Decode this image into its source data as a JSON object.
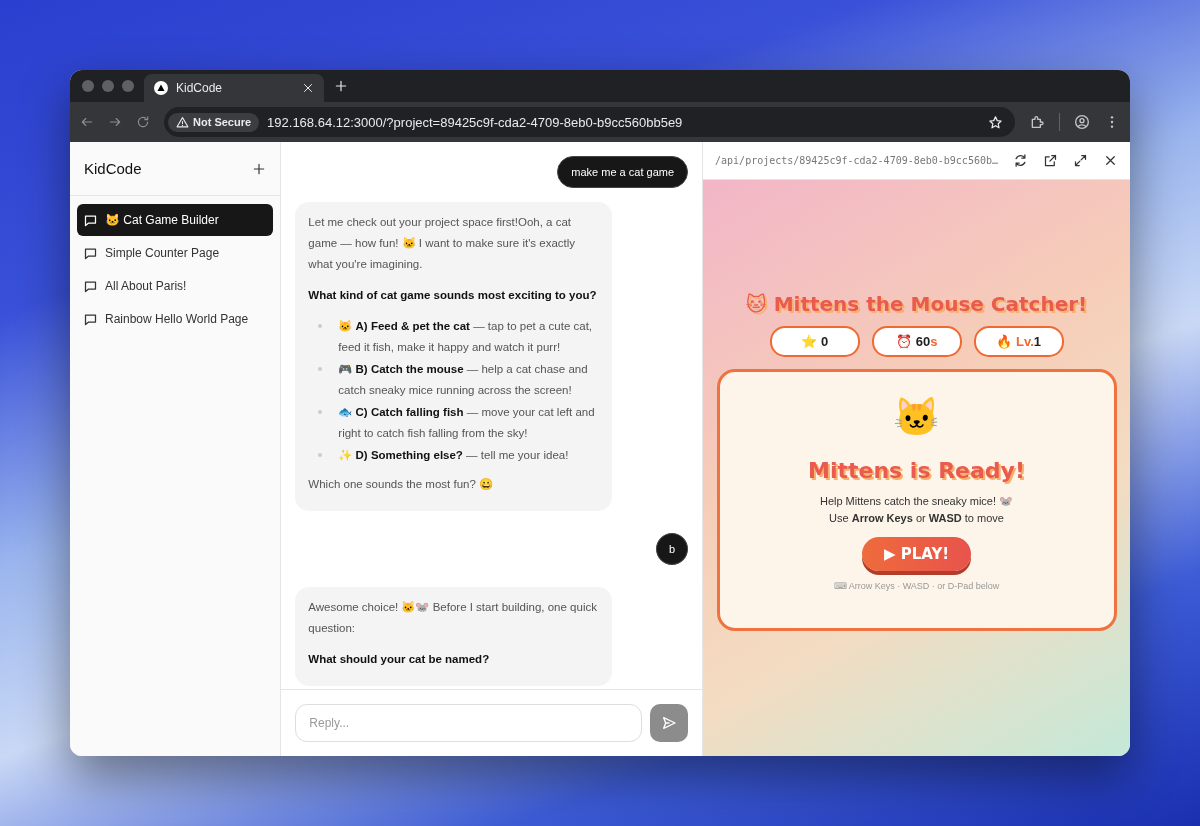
{
  "browser": {
    "tab": {
      "title": "KidCode",
      "selected": true
    },
    "security": "Not Secure",
    "url": "192.168.64.12:3000/?project=89425c9f-cda2-4709-8eb0-b9cc560bb5e9"
  },
  "sidebar": {
    "title": "KidCode",
    "items": [
      {
        "label": "🐱 Cat Game Builder",
        "selected": true
      },
      {
        "label": "Simple Counter Page",
        "selected": false
      },
      {
        "label": "All About Paris!",
        "selected": false
      },
      {
        "label": "Rainbow Hello World Page",
        "selected": false
      }
    ]
  },
  "chat": {
    "messages": [
      {
        "kind": "user",
        "text": "make me a cat game"
      },
      {
        "kind": "assistant",
        "blocks": [
          {
            "kind": "p",
            "text": "Let me check out your project space first!Ooh, a cat game — how fun! 🐱 I want to make sure it's exactly what you're imagining."
          },
          {
            "kind": "q",
            "text": "What kind of cat game sounds most exciting to you?"
          },
          {
            "kind": "list",
            "items": [
              "🐱 **A) Feed & pet the cat** — tap to pet a cute cat, feed it fish, make it happy and watch it purr!",
              "🎮 **B) Catch the mouse** — help a cat chase and catch sneaky mice running across the screen!",
              "🐟 **C) Catch falling fish** — move your cat left and right to catch fish falling from the sky!",
              "✨ **D) Something else?** — tell me your idea!"
            ]
          },
          {
            "kind": "p",
            "text": "Which one sounds the most fun? 😀"
          }
        ]
      },
      {
        "kind": "user",
        "text": "b"
      },
      {
        "kind": "assistant",
        "blocks": [
          {
            "kind": "p",
            "text": "Awesome choice! 🐱🐭 Before I start building, one quick question:"
          },
          {
            "kind": "q",
            "text": "What should your cat be named?"
          }
        ]
      }
    ],
    "reply": {
      "placeholder": "Reply..."
    }
  },
  "preview": {
    "path": "/api/projects/89425c9f-cda2-4709-8eb0-b9cc560b…",
    "game": {
      "title": "🐱 Mittens the Mouse Catcher!",
      "stats": [
        {
          "emoji": "⭐",
          "parts": [
            {
              "text": "0",
              "accent": false
            }
          ]
        },
        {
          "emoji": "⏰",
          "parts": [
            {
              "text": "60",
              "accent": false
            },
            {
              "text": "s",
              "accent": true
            }
          ]
        },
        {
          "emoji": "🔥",
          "parts": [
            {
              "text": "Lv.",
              "accent": true
            },
            {
              "text": "1",
              "accent": false
            }
          ]
        }
      ],
      "card": {
        "emoji": "🐱",
        "heading": "Mittens is Ready!",
        "lines": [
          "Help Mittens catch the sneaky mice! 🐭",
          "Use **Arrow Keys** or **WASD** to move"
        ],
        "button": "▶ PLAY!",
        "hint": "⌨ Arrow Keys · WASD · or D-Pad below"
      }
    }
  }
}
